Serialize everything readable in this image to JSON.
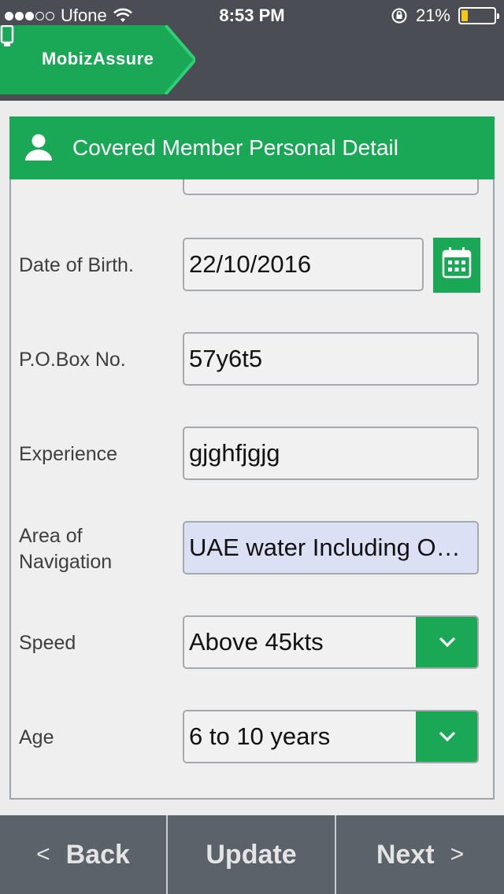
{
  "status_bar": {
    "carrier": "Ufone",
    "time": "8:53 PM",
    "battery_percent": "21%",
    "battery_level": 0.21
  },
  "app": {
    "brand": "MobizAssure",
    "brand_icon": "phone-icon",
    "accent_color": "#1aa857"
  },
  "form": {
    "title": "Covered Member Personal Detail",
    "header_icon": "person-icon",
    "fields": [
      {
        "label": "Date of Birth.",
        "value": "22/10/2016",
        "type": "date"
      },
      {
        "label": "P.O.Box No.",
        "value": "57y6t5",
        "type": "text"
      },
      {
        "label": "Experience",
        "value": "gjghfjgjg",
        "type": "text"
      },
      {
        "label": "Area of Navigation",
        "value": "UAE water Including Oman",
        "type": "text"
      },
      {
        "label": "Speed",
        "value": "Above 45kts",
        "type": "select"
      },
      {
        "label": "Age",
        "value": "6 to 10 years",
        "type": "select"
      }
    ]
  },
  "actions": {
    "back_label": "Back",
    "update_label": "Update",
    "next_label": "Next"
  }
}
